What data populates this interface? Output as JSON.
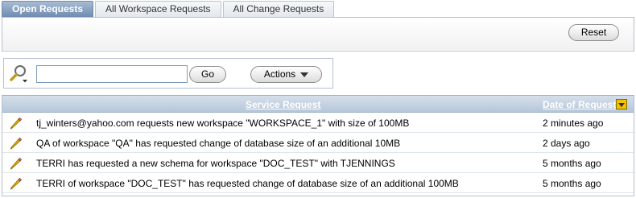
{
  "tabs": [
    {
      "label": "Open Requests",
      "active": true
    },
    {
      "label": "All Workspace Requests",
      "active": false
    },
    {
      "label": "All Change Requests",
      "active": false
    }
  ],
  "toolbar": {
    "reset_label": "Reset"
  },
  "search": {
    "value": "",
    "placeholder": "",
    "go_label": "Go",
    "actions_label": "Actions"
  },
  "report": {
    "columns": {
      "service_request": "Service Request",
      "date_of_request": "Date of Request"
    },
    "rows": [
      {
        "request": "tj_winters@yahoo.com requests new workspace \"WORKSPACE_1\" with size of 100MB",
        "date": "2 minutes ago"
      },
      {
        "request": "QA of workspace \"QA\" has requested change of database size of an additional 10MB",
        "date": "2 days ago"
      },
      {
        "request": "TERRI has requested a new schema for workspace \"DOC_TEST\" with TJENNINGS",
        "date": "5 months ago"
      },
      {
        "request": "TERRI of workspace \"DOC_TEST\" has requested change of database size of an additional 100MB",
        "date": "5 months ago"
      }
    ]
  },
  "colors": {
    "tab_active": "#6f8cb0",
    "header_bg": "#b6c7da",
    "sort_icon": "#f2c200"
  },
  "icons": {
    "search": "magnifier-icon",
    "edit": "pencil-icon",
    "sort": "sort-desc-icon",
    "dropdown": "chevron-down-icon"
  }
}
